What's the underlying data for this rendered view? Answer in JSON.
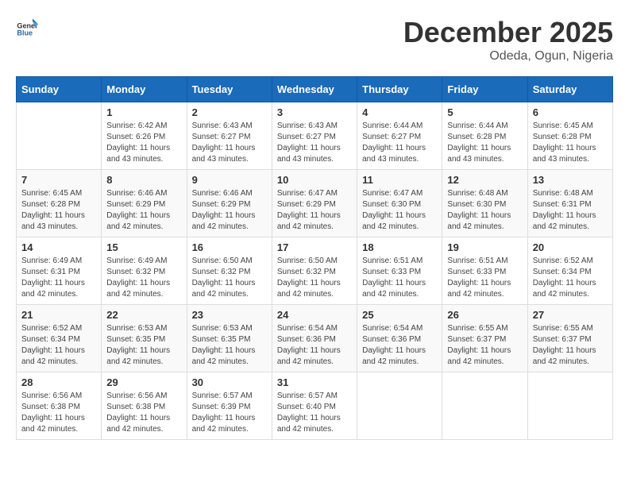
{
  "header": {
    "logo_general": "General",
    "logo_blue": "Blue",
    "month": "December 2025",
    "location": "Odeda, Ogun, Nigeria"
  },
  "weekdays": [
    "Sunday",
    "Monday",
    "Tuesday",
    "Wednesday",
    "Thursday",
    "Friday",
    "Saturday"
  ],
  "weeks": [
    [
      {
        "day": "",
        "sunrise": "",
        "sunset": "",
        "daylight": ""
      },
      {
        "day": "1",
        "sunrise": "Sunrise: 6:42 AM",
        "sunset": "Sunset: 6:26 PM",
        "daylight": "Daylight: 11 hours and 43 minutes."
      },
      {
        "day": "2",
        "sunrise": "Sunrise: 6:43 AM",
        "sunset": "Sunset: 6:27 PM",
        "daylight": "Daylight: 11 hours and 43 minutes."
      },
      {
        "day": "3",
        "sunrise": "Sunrise: 6:43 AM",
        "sunset": "Sunset: 6:27 PM",
        "daylight": "Daylight: 11 hours and 43 minutes."
      },
      {
        "day": "4",
        "sunrise": "Sunrise: 6:44 AM",
        "sunset": "Sunset: 6:27 PM",
        "daylight": "Daylight: 11 hours and 43 minutes."
      },
      {
        "day": "5",
        "sunrise": "Sunrise: 6:44 AM",
        "sunset": "Sunset: 6:28 PM",
        "daylight": "Daylight: 11 hours and 43 minutes."
      },
      {
        "day": "6",
        "sunrise": "Sunrise: 6:45 AM",
        "sunset": "Sunset: 6:28 PM",
        "daylight": "Daylight: 11 hours and 43 minutes."
      }
    ],
    [
      {
        "day": "7",
        "sunrise": "Sunrise: 6:45 AM",
        "sunset": "Sunset: 6:28 PM",
        "daylight": "Daylight: 11 hours and 43 minutes."
      },
      {
        "day": "8",
        "sunrise": "Sunrise: 6:46 AM",
        "sunset": "Sunset: 6:29 PM",
        "daylight": "Daylight: 11 hours and 42 minutes."
      },
      {
        "day": "9",
        "sunrise": "Sunrise: 6:46 AM",
        "sunset": "Sunset: 6:29 PM",
        "daylight": "Daylight: 11 hours and 42 minutes."
      },
      {
        "day": "10",
        "sunrise": "Sunrise: 6:47 AM",
        "sunset": "Sunset: 6:29 PM",
        "daylight": "Daylight: 11 hours and 42 minutes."
      },
      {
        "day": "11",
        "sunrise": "Sunrise: 6:47 AM",
        "sunset": "Sunset: 6:30 PM",
        "daylight": "Daylight: 11 hours and 42 minutes."
      },
      {
        "day": "12",
        "sunrise": "Sunrise: 6:48 AM",
        "sunset": "Sunset: 6:30 PM",
        "daylight": "Daylight: 11 hours and 42 minutes."
      },
      {
        "day": "13",
        "sunrise": "Sunrise: 6:48 AM",
        "sunset": "Sunset: 6:31 PM",
        "daylight": "Daylight: 11 hours and 42 minutes."
      }
    ],
    [
      {
        "day": "14",
        "sunrise": "Sunrise: 6:49 AM",
        "sunset": "Sunset: 6:31 PM",
        "daylight": "Daylight: 11 hours and 42 minutes."
      },
      {
        "day": "15",
        "sunrise": "Sunrise: 6:49 AM",
        "sunset": "Sunset: 6:32 PM",
        "daylight": "Daylight: 11 hours and 42 minutes."
      },
      {
        "day": "16",
        "sunrise": "Sunrise: 6:50 AM",
        "sunset": "Sunset: 6:32 PM",
        "daylight": "Daylight: 11 hours and 42 minutes."
      },
      {
        "day": "17",
        "sunrise": "Sunrise: 6:50 AM",
        "sunset": "Sunset: 6:32 PM",
        "daylight": "Daylight: 11 hours and 42 minutes."
      },
      {
        "day": "18",
        "sunrise": "Sunrise: 6:51 AM",
        "sunset": "Sunset: 6:33 PM",
        "daylight": "Daylight: 11 hours and 42 minutes."
      },
      {
        "day": "19",
        "sunrise": "Sunrise: 6:51 AM",
        "sunset": "Sunset: 6:33 PM",
        "daylight": "Daylight: 11 hours and 42 minutes."
      },
      {
        "day": "20",
        "sunrise": "Sunrise: 6:52 AM",
        "sunset": "Sunset: 6:34 PM",
        "daylight": "Daylight: 11 hours and 42 minutes."
      }
    ],
    [
      {
        "day": "21",
        "sunrise": "Sunrise: 6:52 AM",
        "sunset": "Sunset: 6:34 PM",
        "daylight": "Daylight: 11 hours and 42 minutes."
      },
      {
        "day": "22",
        "sunrise": "Sunrise: 6:53 AM",
        "sunset": "Sunset: 6:35 PM",
        "daylight": "Daylight: 11 hours and 42 minutes."
      },
      {
        "day": "23",
        "sunrise": "Sunrise: 6:53 AM",
        "sunset": "Sunset: 6:35 PM",
        "daylight": "Daylight: 11 hours and 42 minutes."
      },
      {
        "day": "24",
        "sunrise": "Sunrise: 6:54 AM",
        "sunset": "Sunset: 6:36 PM",
        "daylight": "Daylight: 11 hours and 42 minutes."
      },
      {
        "day": "25",
        "sunrise": "Sunrise: 6:54 AM",
        "sunset": "Sunset: 6:36 PM",
        "daylight": "Daylight: 11 hours and 42 minutes."
      },
      {
        "day": "26",
        "sunrise": "Sunrise: 6:55 AM",
        "sunset": "Sunset: 6:37 PM",
        "daylight": "Daylight: 11 hours and 42 minutes."
      },
      {
        "day": "27",
        "sunrise": "Sunrise: 6:55 AM",
        "sunset": "Sunset: 6:37 PM",
        "daylight": "Daylight: 11 hours and 42 minutes."
      }
    ],
    [
      {
        "day": "28",
        "sunrise": "Sunrise: 6:56 AM",
        "sunset": "Sunset: 6:38 PM",
        "daylight": "Daylight: 11 hours and 42 minutes."
      },
      {
        "day": "29",
        "sunrise": "Sunrise: 6:56 AM",
        "sunset": "Sunset: 6:38 PM",
        "daylight": "Daylight: 11 hours and 42 minutes."
      },
      {
        "day": "30",
        "sunrise": "Sunrise: 6:57 AM",
        "sunset": "Sunset: 6:39 PM",
        "daylight": "Daylight: 11 hours and 42 minutes."
      },
      {
        "day": "31",
        "sunrise": "Sunrise: 6:57 AM",
        "sunset": "Sunset: 6:40 PM",
        "daylight": "Daylight: 11 hours and 42 minutes."
      },
      {
        "day": "",
        "sunrise": "",
        "sunset": "",
        "daylight": ""
      },
      {
        "day": "",
        "sunrise": "",
        "sunset": "",
        "daylight": ""
      },
      {
        "day": "",
        "sunrise": "",
        "sunset": "",
        "daylight": ""
      }
    ]
  ]
}
